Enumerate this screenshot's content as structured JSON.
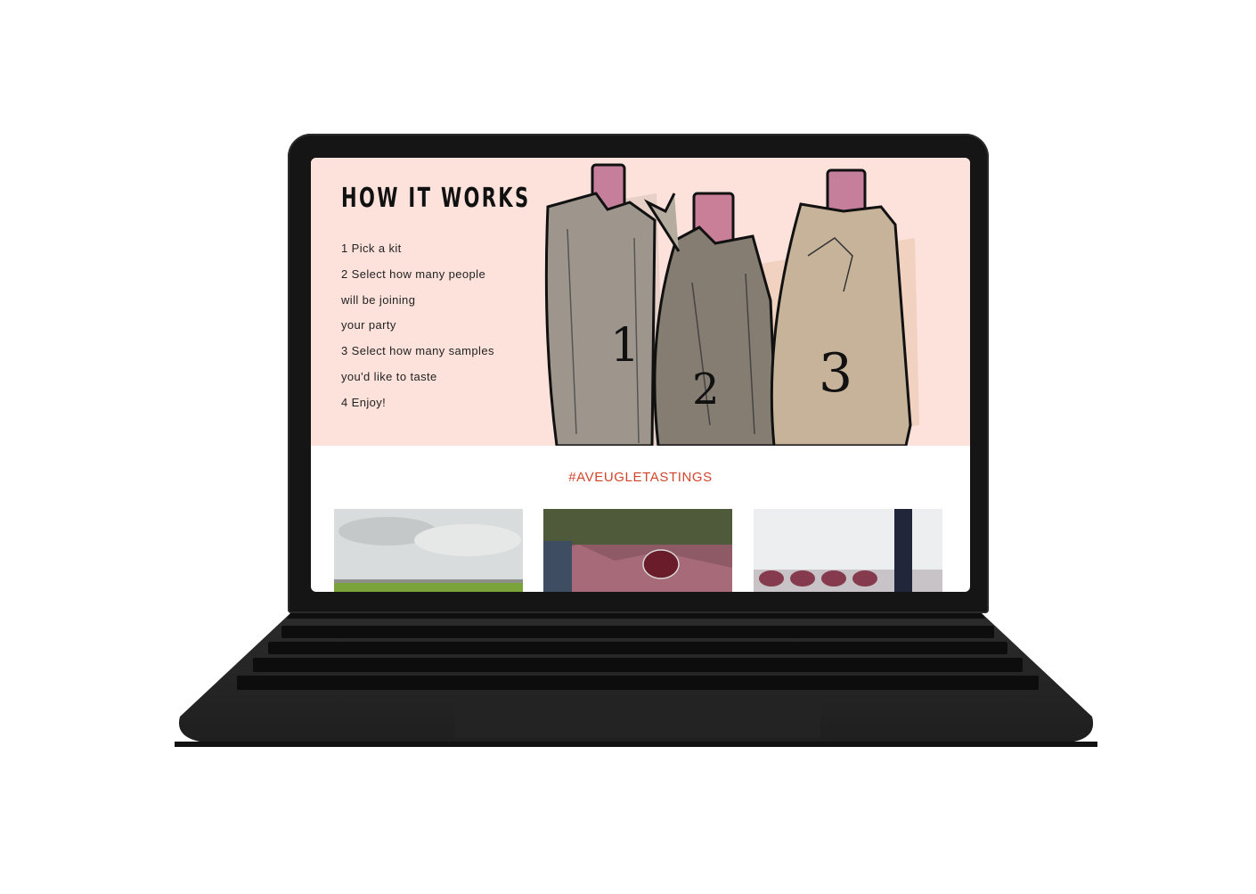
{
  "device": "laptop-mockup",
  "page": {
    "how_it_works": {
      "title": "HOW IT WORKS",
      "steps": [
        "1 Pick a kit",
        "2 Select how many people",
        "will be joining",
        "your party",
        "3 Select how many samples",
        "you'd like to taste",
        "4 Enjoy!"
      ],
      "illustration": {
        "description_icon": "paper-bagged-wine-bottles",
        "bottle_numbers": [
          "1",
          "2",
          "3"
        ]
      }
    },
    "gallery": {
      "hashtag": "#AVEUGLETASTINGS",
      "photos": [
        {
          "name": "field-landscape-photo"
        },
        {
          "name": "picnic-wine-glass-photo"
        },
        {
          "name": "wine-glasses-bottle-photo"
        }
      ]
    }
  },
  "colors": {
    "hero_background": "#fde2dc",
    "accent": "#d2452d",
    "laptop_body": "#151515"
  }
}
